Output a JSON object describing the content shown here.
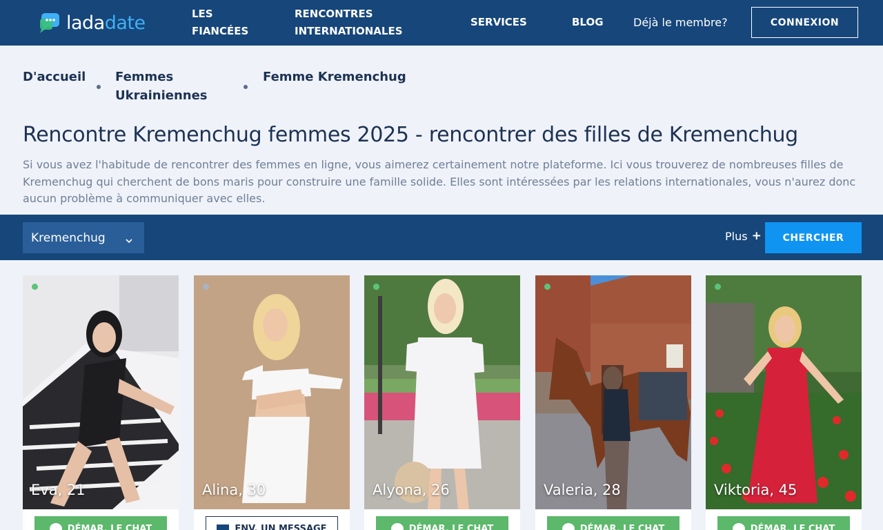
{
  "header": {
    "logo": {
      "part1": "lada",
      "part2": "date"
    },
    "nav": [
      "LES FIANCÉES",
      "RENCONTRES INTERNATIONALES",
      "SERVICES",
      "BLOG"
    ],
    "member_text": "Déjà le membre?",
    "login_label": "CONNEXION"
  },
  "breadcrumb": [
    "D'accueil",
    "Femmes Ukrainiennes",
    "Femme Kremenchug"
  ],
  "page": {
    "title": "Rencontre Kremenchug femmes 2025 - rencontrer des filles de Kremenchug",
    "description": "Si vous avez l'habitude de rencontrer des femmes en ligne, vous aimerez certainement notre plateforme. Ici vous trouverez de nombreuses filles de Kremenchug qui cherchent de bons maris pour construire une famille solide. Elles sont intéressées par les relations internationales, vous n'aurez donc aucun problème à communiquer avec elles."
  },
  "filter": {
    "city": "Kremenchug",
    "more_label": "Plus",
    "more_icon": "plus-icon",
    "search_label": "CHERCHER"
  },
  "colors": {
    "header_bg": "#16467a",
    "accent_blue": "#1094f2",
    "chat_green": "#5cb86b",
    "online": "#5cc47a",
    "offline": "#aab3c0"
  },
  "profiles": [
    {
      "name": "Eva, 21",
      "online": true,
      "button": "DÉMAR. LE CHAT",
      "button_type": "chat"
    },
    {
      "name": "Alina, 30",
      "online": false,
      "button": "ENV. UN MESSAGE",
      "button_type": "message"
    },
    {
      "name": "Alyona, 26",
      "online": true,
      "button": "DÉMAR. LE CHAT",
      "button_type": "chat"
    },
    {
      "name": "Valeria, 28",
      "online": true,
      "button": "DÉMAR. LE CHAT",
      "button_type": "chat"
    },
    {
      "name": "Viktoria, 45",
      "online": true,
      "button": "DÉMAR. LE CHAT",
      "button_type": "chat"
    }
  ]
}
